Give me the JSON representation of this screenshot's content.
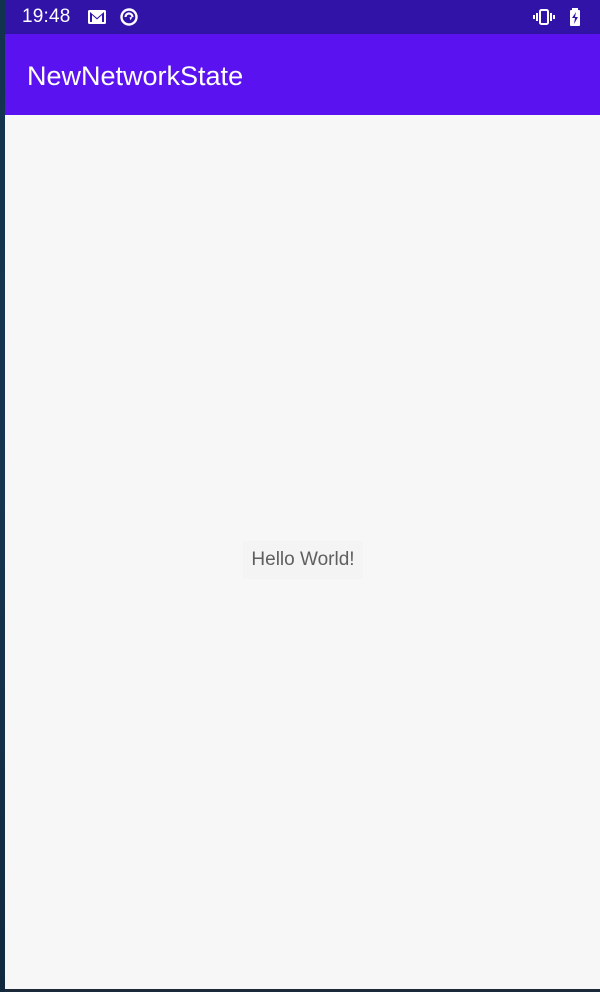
{
  "status_bar": {
    "time": "19:48",
    "icons": [
      "gmail-icon",
      "sync-icon",
      "vibrate-icon",
      "battery-charging-icon"
    ],
    "background": "#3113a8"
  },
  "app_bar": {
    "title": "NewNetworkState",
    "background": "#5b12f0",
    "text_color": "#ffffff"
  },
  "main": {
    "hello_text": "Hello World!",
    "background": "#f6f7f6"
  }
}
